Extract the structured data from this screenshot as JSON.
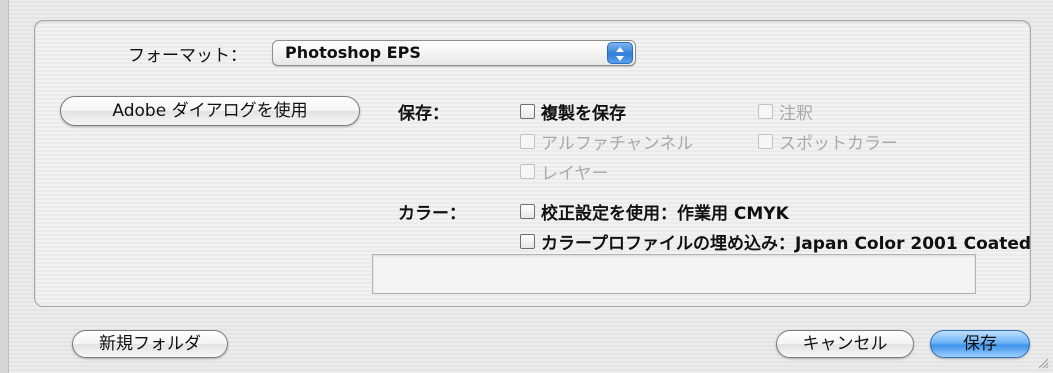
{
  "format": {
    "label": "フォーマット：",
    "selected": "Photoshop EPS"
  },
  "adobe_button_label": "Adobe ダイアログを使用",
  "save_section": {
    "label": "保存：",
    "options": [
      {
        "label": "複製を保存",
        "checked": false,
        "enabled": true
      },
      {
        "label": "注釈",
        "checked": false,
        "enabled": false
      },
      {
        "label": "アルファチャンネル",
        "checked": false,
        "enabled": false
      },
      {
        "label": "スポットカラー",
        "checked": false,
        "enabled": false
      },
      {
        "label": "レイヤー",
        "checked": false,
        "enabled": false
      }
    ]
  },
  "color_section": {
    "label": "カラー：",
    "options": [
      {
        "label": "校正設定を使用：作業用 CMYK",
        "checked": false,
        "enabled": true
      },
      {
        "label": "カラープロファイルの埋め込み：Japan Color 2001 Coated",
        "checked": false,
        "enabled": true
      }
    ]
  },
  "buttons": {
    "new_folder": "新規フォルダ",
    "cancel": "キャンセル",
    "save": "保存"
  },
  "colors": {
    "default_button": "#5aa7f2",
    "disabled_text": "#a9a9a9"
  }
}
